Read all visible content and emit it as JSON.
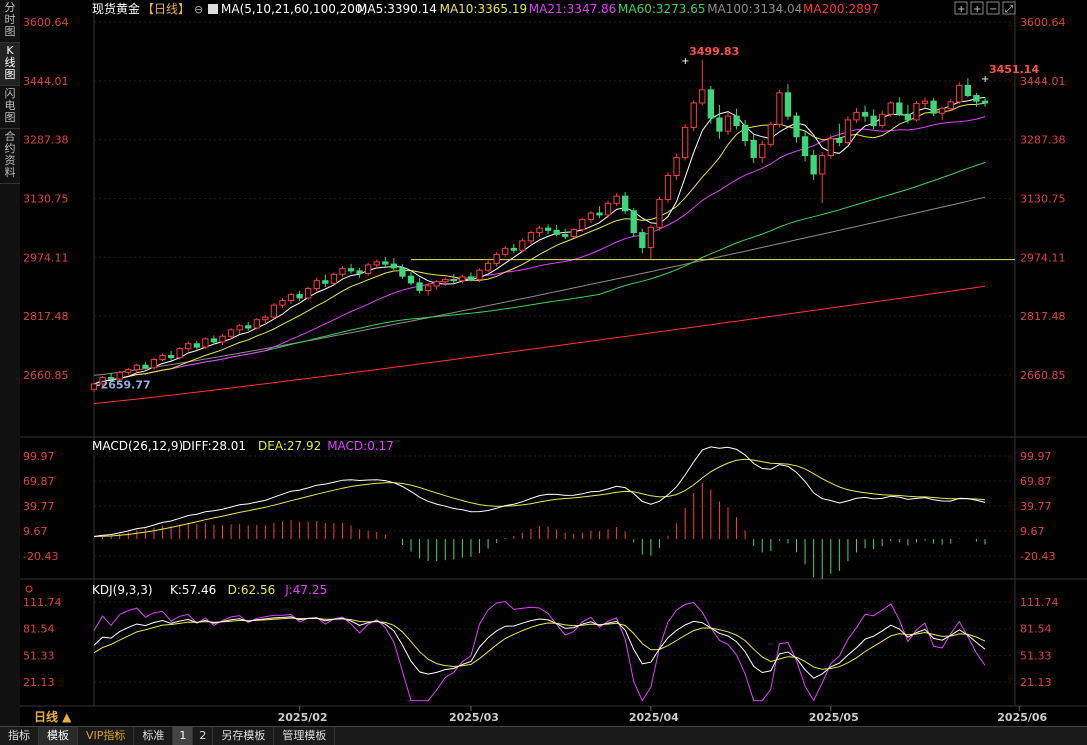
{
  "sidebar": {
    "items": [
      {
        "label": "分时图",
        "active": false
      },
      {
        "label": "K线图",
        "active": true
      },
      {
        "label": "闪电图",
        "active": false
      },
      {
        "label": "合约资料",
        "active": false
      }
    ]
  },
  "bottombar": {
    "tabs": [
      {
        "label": "指标",
        "active": false,
        "vip": false
      },
      {
        "label": "模板",
        "active": true,
        "vip": false
      },
      {
        "label": "VIP指标",
        "active": false,
        "vip": true
      },
      {
        "label": "标准",
        "active": false,
        "vip": false
      },
      {
        "label": "1",
        "active": true,
        "vip": false,
        "num": true
      },
      {
        "label": "2",
        "active": false,
        "vip": false,
        "num": true
      },
      {
        "label": "另存模板",
        "active": false,
        "vip": false
      },
      {
        "label": "管理模板",
        "active": false,
        "vip": false
      }
    ]
  },
  "colors": {
    "up": "#ff3b3b",
    "down": "#3ed67a",
    "ma5": "#ffffff",
    "ma10": "#e8e84a",
    "ma21": "#e040fb",
    "ma60": "#39d353",
    "ma100": "#8c8c8c",
    "ma200": "#ff3333",
    "axisText": "#e04040",
    "grid": "#1c1c1c",
    "hline": "#e8e84a"
  },
  "chart_data": [
    {
      "type": "candlestick",
      "instrument": "现货黄金",
      "period": "【日线】",
      "ma_header": "MA(5,10,21,60,100,200)",
      "ma_values": [
        {
          "name": "MA5",
          "label": "MA5:3390.14",
          "value": 3390.14,
          "color": "#ffffff"
        },
        {
          "name": "MA10",
          "label": "MA10:3365.19",
          "value": 3365.19,
          "color": "#e8e84a"
        },
        {
          "name": "MA21",
          "label": "MA21:3347.86",
          "value": 3347.86,
          "color": "#e040fb"
        },
        {
          "name": "MA60",
          "label": "MA60:3273.65",
          "value": 3273.65,
          "color": "#39d353"
        },
        {
          "name": "MA100",
          "label": "MA100:3134.04",
          "value": 3134.04,
          "color": "#8c8c8c"
        },
        {
          "name": "MA200",
          "label": "MA200:2897",
          "value": 2897,
          "color": "#ff3333"
        }
      ],
      "y_ticks": [
        "3600.64",
        "3444.01",
        "3287.38",
        "3130.75",
        "2974.11",
        "2817.48",
        "2660.85"
      ],
      "ylim": [
        2660.85,
        3600.64
      ],
      "x_ticks": [
        {
          "label": "2025/02",
          "index": 24
        },
        {
          "label": "2025/03",
          "index": 44
        },
        {
          "label": "2025/04",
          "index": 65
        },
        {
          "label": "2025/05",
          "index": 86
        },
        {
          "label": "2025/06",
          "index": 108
        }
      ],
      "annotations": [
        {
          "text": "3499.83",
          "index": 69,
          "value": 3499.83
        },
        {
          "text": "3451.14",
          "index": 104,
          "value": 3451.14
        },
        {
          "text": "2659.77",
          "index": 0,
          "value": 2659.77
        }
      ],
      "horizontal_line": 2968,
      "candles": [
        [
          2623,
          2640,
          2615,
          2637
        ],
        [
          2637,
          2658,
          2630,
          2654
        ],
        [
          2654,
          2666,
          2645,
          2650
        ],
        [
          2650,
          2672,
          2644,
          2668
        ],
        [
          2668,
          2680,
          2660,
          2675
        ],
        [
          2675,
          2691,
          2668,
          2687
        ],
        [
          2687,
          2695,
          2676,
          2680
        ],
        [
          2680,
          2706,
          2675,
          2702
        ],
        [
          2702,
          2718,
          2698,
          2713
        ],
        [
          2713,
          2725,
          2700,
          2707
        ],
        [
          2707,
          2735,
          2702,
          2731
        ],
        [
          2731,
          2749,
          2723,
          2744
        ],
        [
          2744,
          2752,
          2729,
          2735
        ],
        [
          2735,
          2761,
          2731,
          2757
        ],
        [
          2757,
          2766,
          2742,
          2749
        ],
        [
          2749,
          2770,
          2741,
          2764
        ],
        [
          2764,
          2785,
          2757,
          2781
        ],
        [
          2781,
          2797,
          2770,
          2792
        ],
        [
          2792,
          2802,
          2779,
          2786
        ],
        [
          2786,
          2812,
          2782,
          2808
        ],
        [
          2808,
          2820,
          2797,
          2815
        ],
        [
          2815,
          2852,
          2809,
          2847
        ],
        [
          2847,
          2865,
          2838,
          2859
        ],
        [
          2859,
          2880,
          2850,
          2875
        ],
        [
          2875,
          2885,
          2858,
          2866
        ],
        [
          2866,
          2896,
          2860,
          2891
        ],
        [
          2891,
          2920,
          2884,
          2912
        ],
        [
          2912,
          2928,
          2895,
          2905
        ],
        [
          2905,
          2934,
          2901,
          2929
        ],
        [
          2929,
          2951,
          2922,
          2944
        ],
        [
          2944,
          2957,
          2931,
          2938
        ],
        [
          2938,
          2946,
          2920,
          2931
        ],
        [
          2931,
          2960,
          2925,
          2954
        ],
        [
          2954,
          2968,
          2945,
          2962
        ],
        [
          2962,
          2975,
          2950,
          2956
        ],
        [
          2956,
          2972,
          2940,
          2946
        ],
        [
          2946,
          2956,
          2917,
          2924
        ],
        [
          2924,
          2939,
          2900,
          2906
        ],
        [
          2906,
          2920,
          2878,
          2886
        ],
        [
          2886,
          2905,
          2872,
          2898
        ],
        [
          2898,
          2914,
          2888,
          2909
        ],
        [
          2909,
          2921,
          2898,
          2915
        ],
        [
          2915,
          2930,
          2905,
          2912
        ],
        [
          2912,
          2928,
          2904,
          2922
        ],
        [
          2922,
          2934,
          2910,
          2915
        ],
        [
          2915,
          2945,
          2908,
          2940
        ],
        [
          2940,
          2965,
          2934,
          2958
        ],
        [
          2958,
          2988,
          2950,
          2982
        ],
        [
          2982,
          3004,
          2976,
          2998
        ],
        [
          2998,
          3010,
          2985,
          2993
        ],
        [
          2993,
          3025,
          2987,
          3018
        ],
        [
          3018,
          3045,
          3010,
          3040
        ],
        [
          3040,
          3058,
          3028,
          3052
        ],
        [
          3052,
          3062,
          3036,
          3046
        ],
        [
          3046,
          3060,
          3030,
          3035
        ],
        [
          3035,
          3050,
          3022,
          3030
        ],
        [
          3030,
          3052,
          3026,
          3048
        ],
        [
          3048,
          3080,
          3042,
          3075
        ],
        [
          3075,
          3098,
          3066,
          3092
        ],
        [
          3092,
          3110,
          3078,
          3087
        ],
        [
          3087,
          3125,
          3080,
          3118
        ],
        [
          3118,
          3145,
          3110,
          3137
        ],
        [
          3137,
          3148,
          3090,
          3098
        ],
        [
          3098,
          3105,
          3030,
          3040
        ],
        [
          3040,
          3050,
          2985,
          3000
        ],
        [
          3000,
          3060,
          2970,
          3054
        ],
        [
          3054,
          3135,
          3045,
          3128
        ],
        [
          3128,
          3200,
          3120,
          3192
        ],
        [
          3192,
          3250,
          3180,
          3240
        ],
        [
          3240,
          3328,
          3232,
          3320
        ],
        [
          3320,
          3392,
          3310,
          3385
        ],
        [
          3385,
          3500,
          3378,
          3420
        ],
        [
          3420,
          3430,
          3330,
          3345
        ],
        [
          3345,
          3380,
          3290,
          3310
        ],
        [
          3310,
          3360,
          3300,
          3350
        ],
        [
          3350,
          3370,
          3315,
          3325
        ],
        [
          3325,
          3340,
          3270,
          3285
        ],
        [
          3285,
          3300,
          3225,
          3240
        ],
        [
          3240,
          3285,
          3225,
          3275
        ],
        [
          3275,
          3335,
          3268,
          3328
        ],
        [
          3328,
          3420,
          3320,
          3412
        ],
        [
          3412,
          3435,
          3340,
          3350
        ],
        [
          3350,
          3360,
          3280,
          3295
        ],
        [
          3295,
          3310,
          3230,
          3245
        ],
        [
          3245,
          3260,
          3180,
          3196
        ],
        [
          3196,
          3255,
          3118,
          3245
        ],
        [
          3245,
          3300,
          3236,
          3290
        ],
        [
          3290,
          3330,
          3270,
          3280
        ],
        [
          3280,
          3350,
          3275,
          3340
        ],
        [
          3340,
          3372,
          3332,
          3360
        ],
        [
          3360,
          3378,
          3335,
          3350
        ],
        [
          3350,
          3368,
          3316,
          3325
        ],
        [
          3325,
          3365,
          3318,
          3355
        ],
        [
          3355,
          3390,
          3348,
          3385
        ],
        [
          3385,
          3400,
          3350,
          3355
        ],
        [
          3355,
          3380,
          3330,
          3340
        ],
        [
          3340,
          3390,
          3335,
          3384
        ],
        [
          3384,
          3400,
          3370,
          3390
        ],
        [
          3390,
          3398,
          3350,
          3358
        ],
        [
          3358,
          3375,
          3340,
          3370
        ],
        [
          3370,
          3395,
          3365,
          3388
        ],
        [
          3388,
          3440,
          3382,
          3432
        ],
        [
          3432,
          3451,
          3400,
          3405
        ],
        [
          3405,
          3412,
          3375,
          3390
        ],
        [
          3390,
          3400,
          3375,
          3385
        ]
      ]
    },
    {
      "type": "macd",
      "header": "MACD(26,12,9)",
      "values": [
        {
          "name": "DIFF",
          "label": "DIFF:28.01",
          "value": 28.01,
          "color": "#ffffff"
        },
        {
          "name": "DEA",
          "label": "DEA:27.92",
          "value": 27.92,
          "color": "#e8e84a"
        },
        {
          "name": "MACD",
          "label": "MACD:0.17",
          "value": 0.17,
          "color": "#e040fb"
        }
      ],
      "y_ticks": [
        "99.97",
        "69.87",
        "39.77",
        "9.67",
        "-20.43"
      ],
      "ylim": [
        -20.43,
        99.97
      ]
    },
    {
      "type": "kdj",
      "header": "KDJ(9,3,3)",
      "values": [
        {
          "name": "K",
          "label": "K:57.46",
          "value": 57.46,
          "color": "#ffffff"
        },
        {
          "name": "D",
          "label": "D:62.56",
          "value": 62.56,
          "color": "#e8e84a"
        },
        {
          "name": "J",
          "label": "J:47.25",
          "value": 47.25,
          "color": "#e040fb"
        }
      ],
      "y_ticks": [
        "111.74",
        "81.54",
        "51.33",
        "21.13"
      ],
      "ylim": [
        21.13,
        111.74
      ]
    }
  ],
  "footer": {
    "period_label": "日线 ▲"
  },
  "toolbar_icons": [
    "crosshair-icon",
    "plus-box-icon",
    "minus-box-icon",
    "expand-icon"
  ]
}
